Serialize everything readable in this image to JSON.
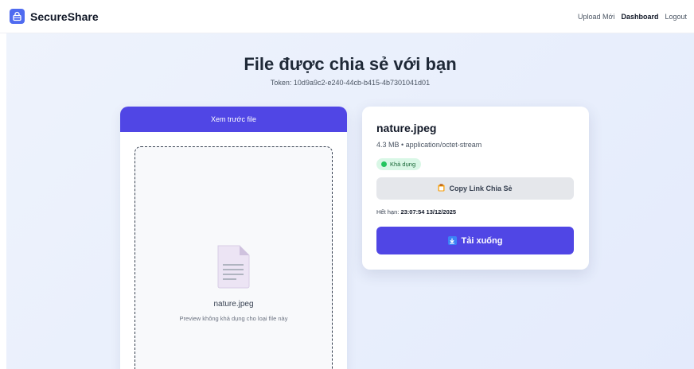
{
  "nav": {
    "brand": "SecureShare",
    "links": [
      "Upload Mới",
      "Dashboard",
      "Logout"
    ],
    "active_link": "Dashboard"
  },
  "page": {
    "title": "File được chia sẻ với bạn",
    "token": "Token: 10d9a9c2-e240-44cb-b415-4b7301041d01"
  },
  "preview": {
    "header": "Xem trước file",
    "file_name": "nature.jpeg",
    "note": "Preview không khả dụng cho loại file này"
  },
  "file_info": {
    "name": "nature.jpeg",
    "meta": "4.3 MB • application/octet-stream",
    "status": "Khả dụng",
    "copy_label": "Copy Link Chia Sẻ",
    "expiry_label": "Hết hạn: ",
    "expiry_value": "23:07:54 13/12/2025",
    "download_label": "Tải xuống"
  },
  "colors": {
    "accent": "#5046e5",
    "brand_logo": "#4f6bf0",
    "status_bg": "#d9f7e6",
    "status_dot": "#22c55e"
  },
  "icons": {
    "brand": "lock-icon",
    "file": "document-icon",
    "copy": "clipboard-icon",
    "download": "download-icon"
  }
}
